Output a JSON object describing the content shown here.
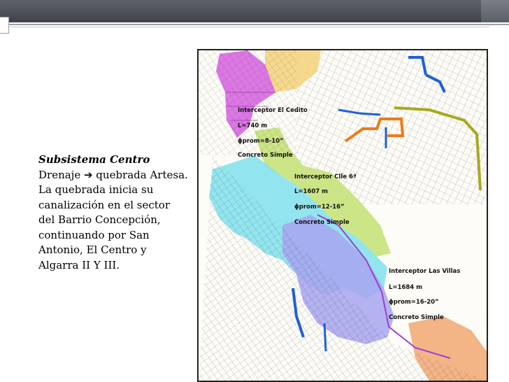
{
  "slide": {
    "title": "Subsistema Centro",
    "lines": [
      "Drenaje ➔ quebrada Artesa.",
      "La quebrada inicia su canalización  en el sector del Barrio Concepción, continuando por San Antonio, El Centro y Algarra II Y III."
    ]
  },
  "map": {
    "interceptors": [
      {
        "name": "Interceptor El Cedito",
        "length": "L=740 m",
        "diameter": "ϕprom=8-10”",
        "material": "Concreto Simple"
      },
      {
        "name": "Interceptor Clle 6ª",
        "length": "L=1607 m",
        "diameter": "ϕprom=12-16”",
        "material": "Concreto Simple"
      },
      {
        "name": "Interceptor Las Villas",
        "length": "L=1684 m",
        "diameter": "ϕprom=16-20”",
        "material": "Concreto Simple"
      }
    ],
    "zone_colors": {
      "magenta": "#d65fe0",
      "yellow": "#f4d27a",
      "green": "#c6e27a",
      "cyan": "#7fe0ec",
      "purple_blue": "#a8a4f0",
      "orange_brown": "#f0a16a",
      "blue_channel": "#1f5fd6",
      "orange_line": "#f07a18",
      "olive_line": "#a8a820",
      "purple_line": "#9a3fd6"
    }
  }
}
